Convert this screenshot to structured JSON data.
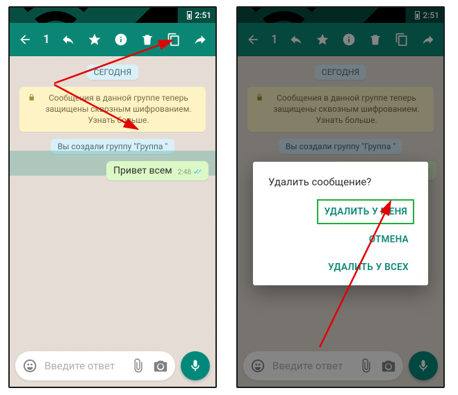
{
  "status": {
    "time": "2:51"
  },
  "appbar": {
    "selected_count": "1"
  },
  "chat": {
    "date_chip": "СЕГОДНЯ",
    "encryption_notice": "Сообщения в данной группе теперь защищены сквозным шифрованием. Узнать больше.",
    "created_group": "Вы создали группу \"Группа \"",
    "message_text": "Привет всем",
    "message_time": "2:48"
  },
  "input": {
    "placeholder": "Введите ответ"
  },
  "dialog": {
    "title": "Удалить сообщение?",
    "delete_for_me": "УДАЛИТЬ У МЕНЯ",
    "cancel": "ОТМЕНА",
    "delete_for_all": "УДАЛИТЬ У ВСЕХ"
  }
}
